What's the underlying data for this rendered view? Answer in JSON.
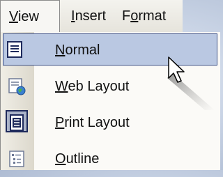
{
  "menubar": {
    "items": [
      {
        "pre": "",
        "ul": "V",
        "post": "iew"
      },
      {
        "pre": "",
        "ul": "I",
        "post": "nsert"
      },
      {
        "pre": "F",
        "ul": "o",
        "post": "rmat"
      }
    ]
  },
  "dropdown": {
    "items": [
      {
        "ul": "N",
        "post": "ormal",
        "icon": "normal-view-icon"
      },
      {
        "ul": "W",
        "post": "eb Layout",
        "icon": "web-layout-icon"
      },
      {
        "ul": "P",
        "post": "rint Layout",
        "icon": "print-layout-icon"
      },
      {
        "ul": "O",
        "post": "utline",
        "icon": "outline-view-icon"
      }
    ]
  }
}
